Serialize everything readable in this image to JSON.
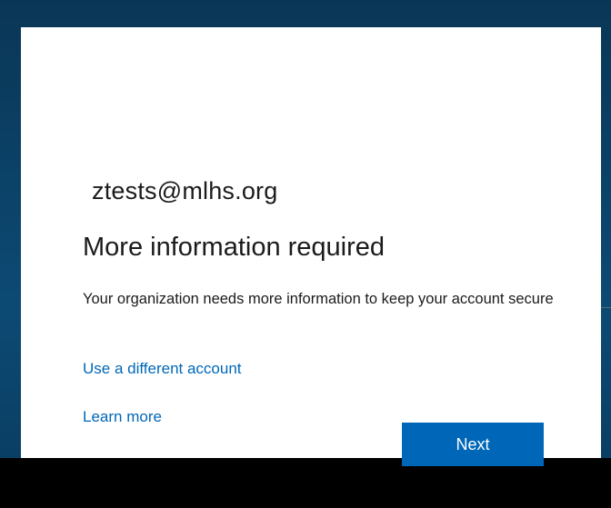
{
  "account": {
    "email": "ztests@mlhs.org"
  },
  "dialog": {
    "title": "More information required",
    "description": "Your organization needs more information to keep your account secure",
    "links": {
      "different_account": "Use a different account",
      "learn_more": "Learn more"
    },
    "next_label": "Next"
  },
  "colors": {
    "accent": "#0067b8",
    "text": "#1b1b1b",
    "background": "#0b3a5e"
  }
}
